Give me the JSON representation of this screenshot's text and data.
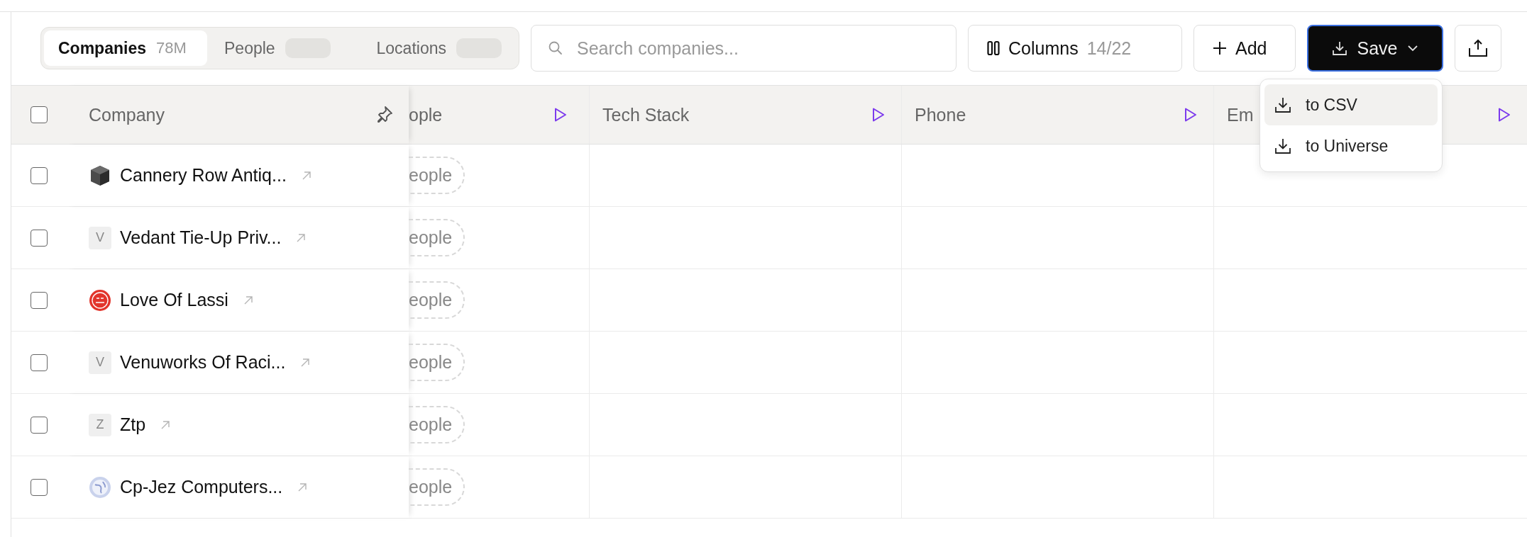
{
  "toolbar": {
    "tabs": [
      {
        "label": "Companies",
        "count": "78M",
        "count_loading": false,
        "selected": true
      },
      {
        "label": "People",
        "count_loading": true,
        "selected": false
      },
      {
        "label": "Locations",
        "count_loading": true,
        "selected": false
      }
    ],
    "search": {
      "placeholder": "Search companies..."
    },
    "columns_button": {
      "label": "Columns",
      "count": "14/22"
    },
    "add_button": {
      "label": "Add"
    },
    "save_button": {
      "label": "Save",
      "expanded": true
    }
  },
  "save_menu": {
    "items": [
      {
        "label": "to CSV",
        "selected": true
      },
      {
        "label": "to Universe",
        "selected": false
      }
    ]
  },
  "table": {
    "all_checked": false,
    "columns": [
      {
        "label": "Company",
        "kind": "pinned"
      },
      {
        "label": "ople",
        "kind": "enrich"
      },
      {
        "label": "Tech Stack",
        "kind": "enrich"
      },
      {
        "label": "Phone",
        "kind": "enrich"
      },
      {
        "label": "Em",
        "kind": "enrich"
      }
    ],
    "rows": [
      {
        "checked": false,
        "kind": "cube",
        "name": "Cannery Row Antiq...",
        "people": "eople"
      },
      {
        "checked": false,
        "kind": "letter",
        "initial": "V",
        "name": "Vedant Tie-Up Priv...",
        "people": "eople"
      },
      {
        "checked": false,
        "kind": "badge",
        "name": "Love Of Lassi",
        "people": "eople"
      },
      {
        "checked": false,
        "kind": "letter",
        "initial": "V",
        "name": "Venuworks Of Raci...",
        "people": "eople"
      },
      {
        "checked": false,
        "kind": "letter",
        "initial": "Z",
        "name": "Ztp",
        "people": "eople"
      },
      {
        "checked": false,
        "kind": "globe",
        "name": "Cp-Jez Computers...",
        "people": "eople"
      }
    ]
  }
}
